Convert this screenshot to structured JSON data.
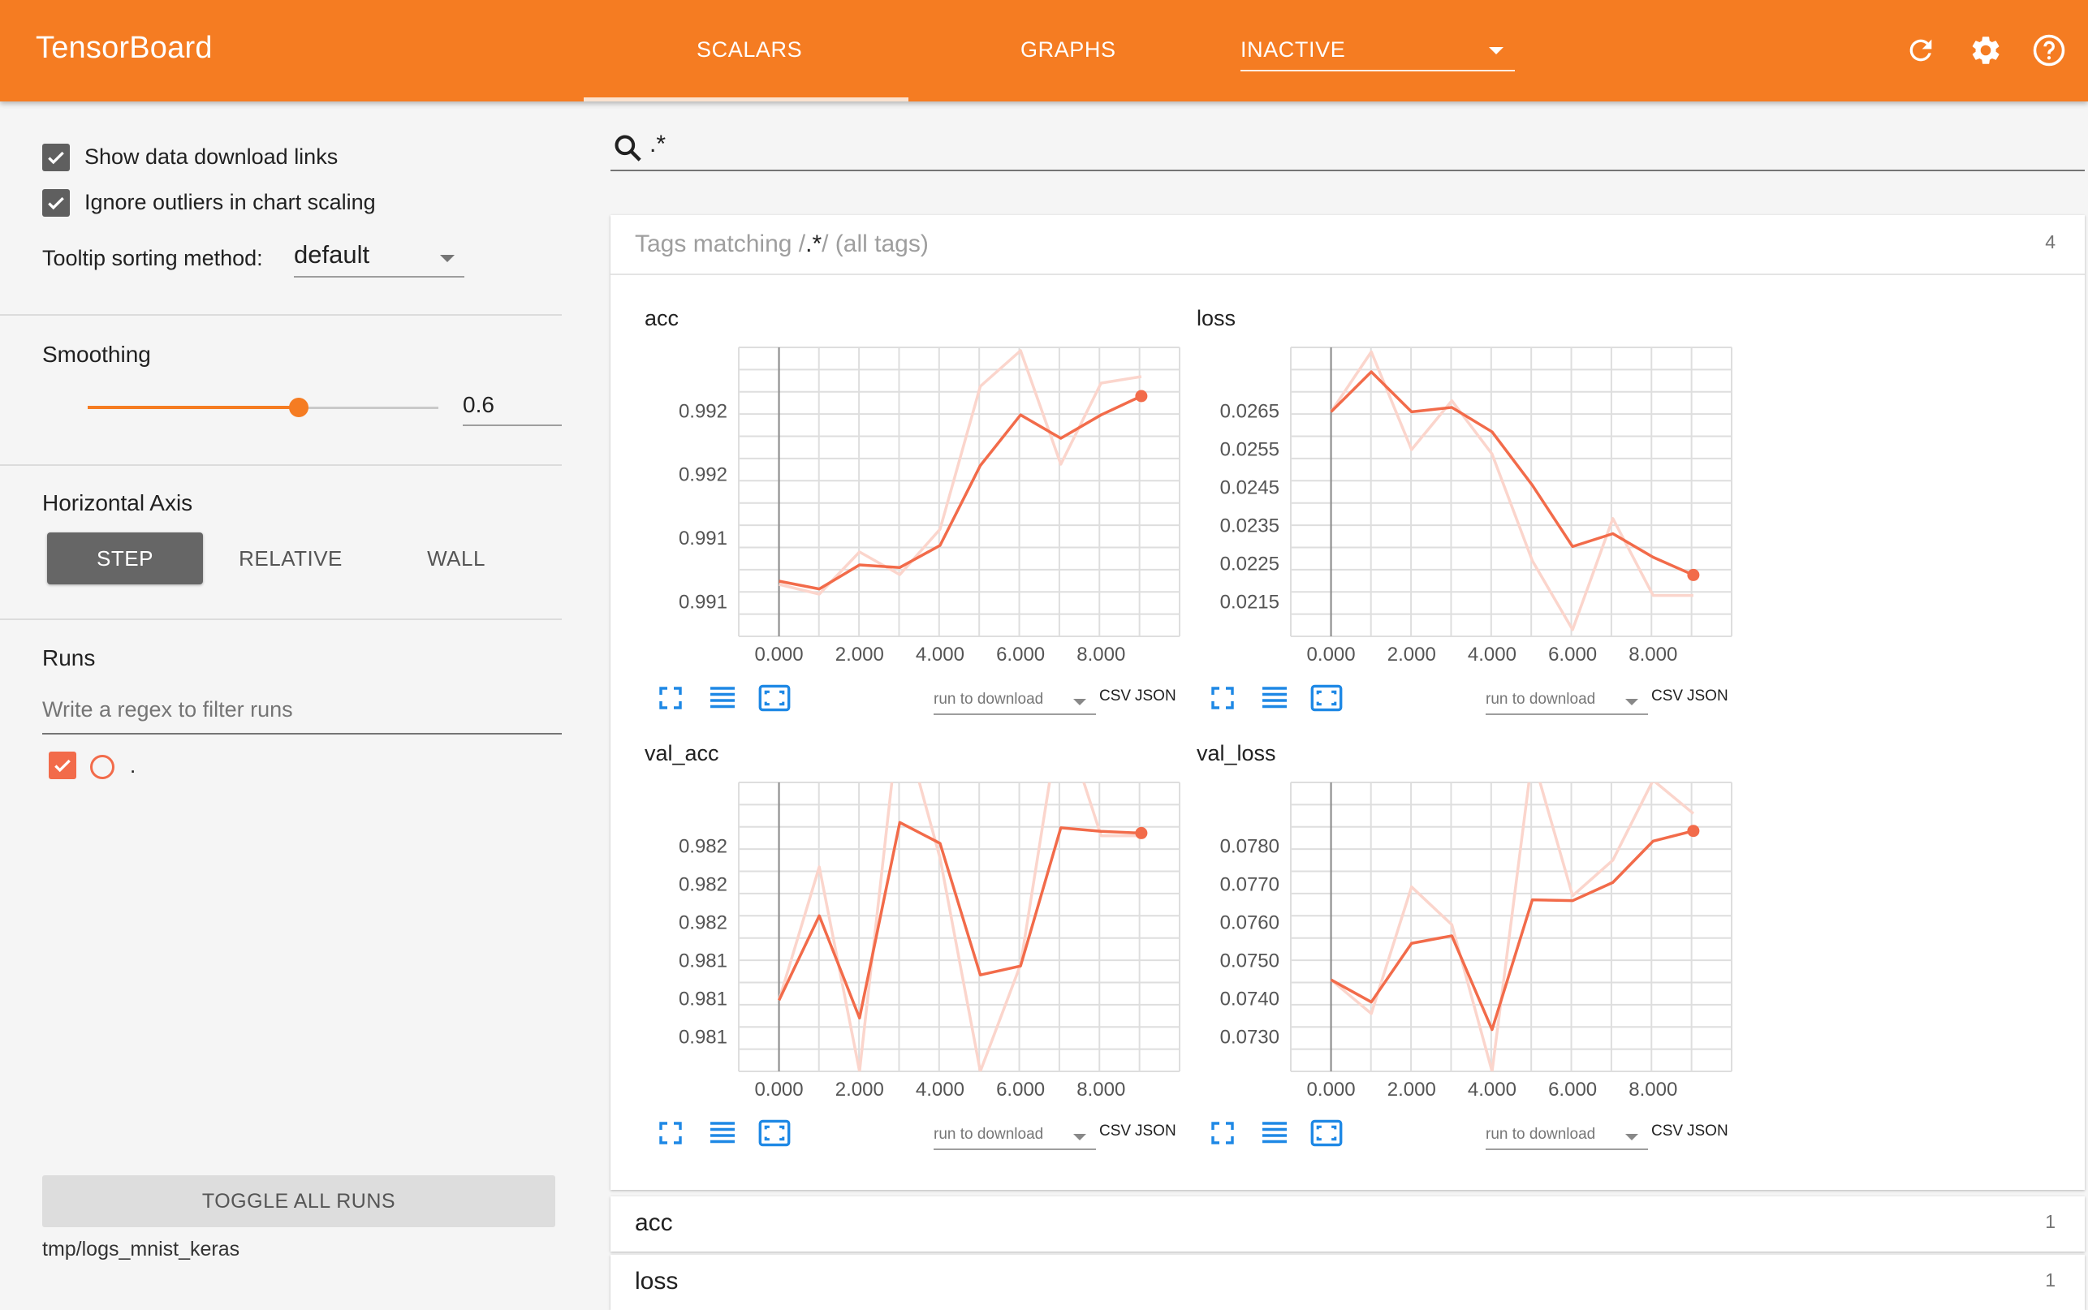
{
  "app": {
    "title": "TensorBoard"
  },
  "nav": {
    "tabs": [
      "SCALARS",
      "GRAPHS"
    ],
    "inactive_label": "INACTIVE"
  },
  "sidebar": {
    "show_download_links": {
      "label": "Show data download links",
      "checked": true
    },
    "ignore_outliers": {
      "label": "Ignore outliers in chart scaling",
      "checked": true
    },
    "tooltip_label": "Tooltip sorting method:",
    "tooltip_value": "default",
    "smoothing_label": "Smoothing",
    "smoothing_value": "0.6",
    "horizontal_axis_label": "Horizontal Axis",
    "axis_options": [
      "STEP",
      "RELATIVE",
      "WALL"
    ],
    "axis_selected": "STEP",
    "runs_label": "Runs",
    "runs_filter_placeholder": "Write a regex to filter runs",
    "runs": [
      {
        "name": ".",
        "checked": true
      }
    ],
    "toggle_all_label": "TOGGLE ALL RUNS",
    "logdir": "tmp/logs_mnist_keras"
  },
  "search": {
    "value": ".*"
  },
  "tag_group": {
    "prefix": "Tags matching /",
    "pattern": ".*",
    "suffix": "/ (all tags)",
    "count": "4"
  },
  "download": {
    "run_placeholder": "run to download",
    "csv": "CSV",
    "json": "JSON"
  },
  "collapsed_groups": [
    {
      "name": "acc",
      "count": "1"
    },
    {
      "name": "loss",
      "count": "1"
    }
  ],
  "colors": {
    "accent": "#f57c22",
    "series": "#f26b4a",
    "series_raw": "#fbd5cc"
  },
  "chart_data": [
    {
      "type": "line",
      "title": "acc",
      "x": [
        0,
        1,
        2,
        3,
        4,
        5,
        6,
        7,
        8,
        9
      ],
      "xticks": [
        "0.000",
        "2.000",
        "4.000",
        "6.000",
        "8.000"
      ],
      "yticks": [
        "0.991",
        "0.991",
        "0.992",
        "0.992"
      ],
      "ylim": [
        -0.1,
        4.35
      ],
      "series": [
        {
          "role": "smoothed",
          "values": [
            0.75,
            0.63,
            1.0,
            0.96,
            1.3,
            2.53,
            3.31,
            2.95,
            3.31,
            3.6
          ]
        },
        {
          "role": "raw",
          "values": [
            0.7,
            0.55,
            1.2,
            0.85,
            1.55,
            3.75,
            4.3,
            2.55,
            3.8,
            3.9
          ]
        }
      ]
    },
    {
      "type": "line",
      "title": "loss",
      "x": [
        0,
        1,
        2,
        3,
        4,
        5,
        6,
        7,
        8,
        9
      ],
      "xticks": [
        "0.000",
        "2.000",
        "4.000",
        "6.000",
        "8.000"
      ],
      "yticks": [
        "0.0215",
        "0.0225",
        "0.0235",
        "0.0245",
        "0.0255",
        "0.0265"
      ],
      "ylim": [
        0.0207,
        0.0272
      ],
      "series": [
        {
          "role": "smoothed",
          "values": [
            0.02575,
            0.02665,
            0.02575,
            0.02585,
            0.0253,
            0.0241,
            0.02272,
            0.02301,
            0.02248,
            0.02208
          ]
        },
        {
          "role": "raw",
          "values": [
            0.02575,
            0.0271,
            0.0249,
            0.026,
            0.0248,
            0.0224,
            0.02085,
            0.02335,
            0.02162,
            0.02162
          ]
        }
      ]
    },
    {
      "type": "line",
      "title": "val_acc",
      "x": [
        0,
        1,
        2,
        3,
        4,
        5,
        6,
        7,
        8,
        9
      ],
      "xticks": [
        "0.000",
        "2.000",
        "4.000",
        "6.000",
        "8.000"
      ],
      "yticks": [
        "0.981",
        "0.981",
        "0.981",
        "0.982",
        "0.982",
        "0.982"
      ],
      "ylim": [
        -0.6,
        5.9
      ],
      "series": [
        {
          "role": "smoothed",
          "values": [
            1.0,
            2.9,
            0.6,
            5.0,
            4.53,
            1.57,
            1.77,
            4.88,
            4.8,
            4.76
          ]
        },
        {
          "role": "raw",
          "values": [
            1.0,
            4.0,
            -0.6,
            7.5,
            4.2,
            -0.6,
            1.8,
            7.5,
            4.7,
            4.7
          ]
        }
      ]
    },
    {
      "type": "line",
      "title": "val_loss",
      "x": [
        0,
        1,
        2,
        3,
        4,
        5,
        6,
        7,
        8,
        9
      ],
      "xticks": [
        "0.000",
        "2.000",
        "4.000",
        "6.000",
        "8.000"
      ],
      "yticks": [
        "0.0730",
        "0.0740",
        "0.0750",
        "0.0760",
        "0.0770",
        "0.0780"
      ],
      "ylim": [
        0.0724,
        0.0789
      ],
      "series": [
        {
          "role": "smoothed",
          "values": [
            0.07446,
            0.07396,
            0.07528,
            0.07545,
            0.07334,
            0.07626,
            0.07624,
            0.07665,
            0.07758,
            0.07781
          ]
        },
        {
          "role": "raw",
          "values": [
            0.07446,
            0.0737,
            0.07655,
            0.0757,
            0.0724,
            0.0795,
            0.07635,
            0.07715,
            0.07895,
            0.0782
          ]
        }
      ]
    }
  ]
}
